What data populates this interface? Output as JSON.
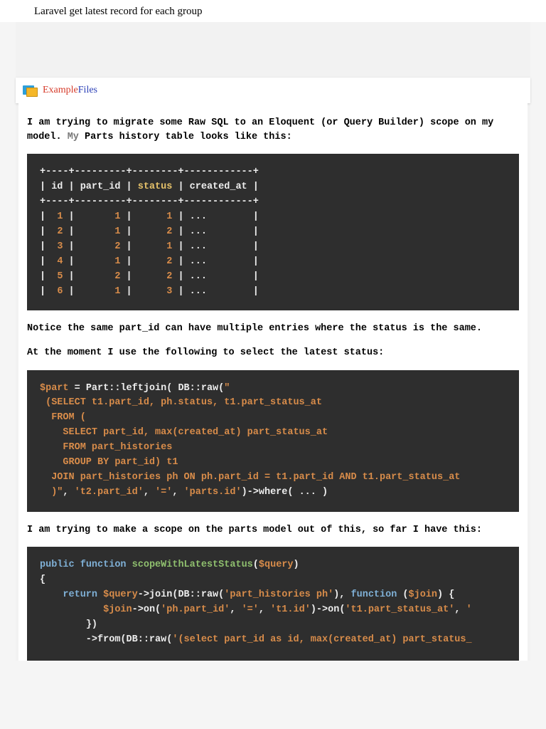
{
  "page_title": "Laravel get latest record for each group",
  "brand": {
    "part1": "Example",
    "part2": "Files"
  },
  "intro": {
    "p1a": "I am trying to migrate some Raw SQL to an Eloquent (or Query Builder) scope on my model.",
    "p1b": " My",
    "p1c": " Parts history table looks like this:"
  },
  "table_block": "+----+---------+--------+------------+\n| id | part_id | <span class=\"tok-hdr\">status</span> | created_at |\n+----+---------+--------+------------+\n|  <span class=\"tok-num\">1</span> |       <span class=\"tok-num\">1</span> |      <span class=\"tok-num\">1</span> | ...        |\n|  <span class=\"tok-num\">2</span> |       <span class=\"tok-num\">1</span> |      <span class=\"tok-num\">2</span> | ...        |\n|  <span class=\"tok-num\">3</span> |       <span class=\"tok-num\">2</span> |      <span class=\"tok-num\">1</span> | ...        |\n|  <span class=\"tok-num\">4</span> |       <span class=\"tok-num\">1</span> |      <span class=\"tok-num\">2</span> | ...        |\n|  <span class=\"tok-num\">5</span> |       <span class=\"tok-num\">2</span> |      <span class=\"tok-num\">2</span> | ...        |\n|  <span class=\"tok-num\">6</span> |       <span class=\"tok-num\">1</span> |      <span class=\"tok-num\">3</span> | ...        |",
  "p2": "Notice the same part_id can have multiple entries where the status is the same.",
  "p3": "At the moment I use the following to select the latest status:",
  "code2": "<span class=\"tok-var\">$part</span> = Part::leftjoin( DB::raw(<span class=\"tok-str\">\"\n (SELECT t1.part_id, ph.status, t1.part_status_at\n  FROM (\n    SELECT part_id, max(created_at) part_status_at\n    FROM part_histories\n    GROUP BY part_id) t1\n  JOIN part_histories ph ON ph.part_id = t1.part_id AND t1.part_status_at\n  )\"</span>, <span class=\"tok-str\">'t2.part_id'</span>, <span class=\"tok-str\">'='</span>, <span class=\"tok-str\">'parts.id'</span>)-&gt;where( ... )",
  "p4": "I am trying to make a scope on the parts model out of this, so far I have this:",
  "code3": "<span class=\"tok-kw\">public</span> <span class=\"tok-kw\">function</span> <span class=\"tok-fn\">scopeWithLatestStatus</span>(<span class=\"tok-var\">$query</span>)\n{\n    <span class=\"tok-kw\">return</span> <span class=\"tok-var\">$query</span>-&gt;join(DB::raw(<span class=\"tok-str\">'part_histories ph'</span>), <span class=\"tok-kw\">function</span> (<span class=\"tok-var\">$join</span>) {\n           <span class=\"tok-var\">$join</span>-&gt;on(<span class=\"tok-str\">'ph.part_id'</span>, <span class=\"tok-str\">'='</span>, <span class=\"tok-str\">'t1.id'</span>)-&gt;on(<span class=\"tok-str\">'t1.part_status_at'</span>, <span class=\"tok-str\">'\n        </span>})\n        -&gt;from(DB::raw(<span class=\"tok-str\">'(select part_id as id, max(created_at) part_status_"
}
